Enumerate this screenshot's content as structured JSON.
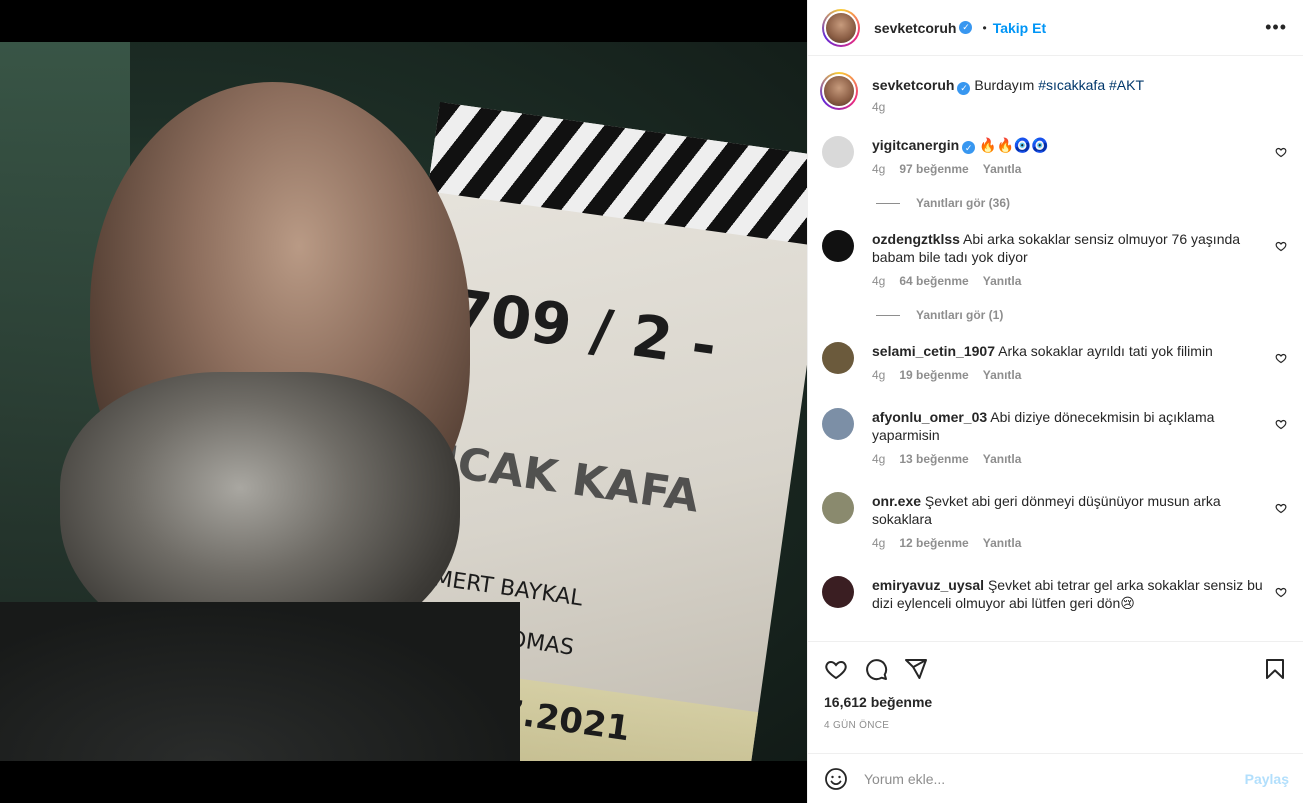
{
  "post": {
    "username": "sevketcoruh",
    "follow_label": "Takip Et",
    "dot": "•",
    "more_icon": "more-horizontal-icon",
    "caption": {
      "text_prefix": "Burdayım ",
      "hashtag1": "#sıcakkafa",
      "hashtag2": "#AKT",
      "age": "4g"
    }
  },
  "media": {
    "slate_text_1": "709 / 2 -",
    "slate_text_2": "SICAK KAFA",
    "slate_text_3": "MERT BAYKAL",
    "slate_text_4": "YON THOMAS",
    "slate_text_5": "23.07.2021"
  },
  "comments": [
    {
      "user": "yigitcanergin",
      "verified": true,
      "text": "🔥🔥🧿🧿",
      "age": "4g",
      "likes": "97 beğenme",
      "reply": "Yanıtla",
      "replies": "Yanıtları gör (36)",
      "avatar_color": "#d9d9d9"
    },
    {
      "user": "ozdengztklss",
      "verified": false,
      "text": "Abi arka sokaklar sensiz olmuyor 76 yaşında babam bile tadı yok diyor",
      "age": "4g",
      "likes": "64 beğenme",
      "reply": "Yanıtla",
      "replies": "Yanıtları gör (1)",
      "avatar_color": "#111111"
    },
    {
      "user": "selami_cetin_1907",
      "verified": false,
      "text": "Arka sokaklar ayrıldı tati yok filimin",
      "age": "4g",
      "likes": "19 beğenme",
      "reply": "Yanıtla",
      "replies": "",
      "avatar_color": "#6b5a3c"
    },
    {
      "user": "afyonlu_omer_03",
      "verified": false,
      "text": "Abi diziye dönecekmisin bi açıklama yaparmisin",
      "age": "4g",
      "likes": "13 beğenme",
      "reply": "Yanıtla",
      "replies": "",
      "avatar_color": "#7c8fa6"
    },
    {
      "user": "onr.exe",
      "verified": false,
      "text": "Şevket abi geri dönmeyi düşünüyor musun arka sokaklara",
      "age": "4g",
      "likes": "12 beğenme",
      "reply": "Yanıtla",
      "replies": "",
      "avatar_color": "#8a8a6e"
    },
    {
      "user": "emiryavuz_uysal",
      "verified": false,
      "text": "Şevket abi tetrar gel arka sokaklar sensiz bu dizi eylenceli olmuyor abi lütfen geri dön😢",
      "age": "",
      "likes": "",
      "reply": "",
      "replies": "",
      "avatar_color": "#3a1e22"
    }
  ],
  "footer": {
    "likes": "16,612 beğenme",
    "date": "4 GÜN ÖNCE",
    "comment_placeholder": "Yorum ekle...",
    "post_label": "Paylaş"
  },
  "colors": {
    "accent": "#0095f6",
    "verified": "#3897f0",
    "muted": "#8e8e8e",
    "post_disabled": "#b2dffc"
  }
}
